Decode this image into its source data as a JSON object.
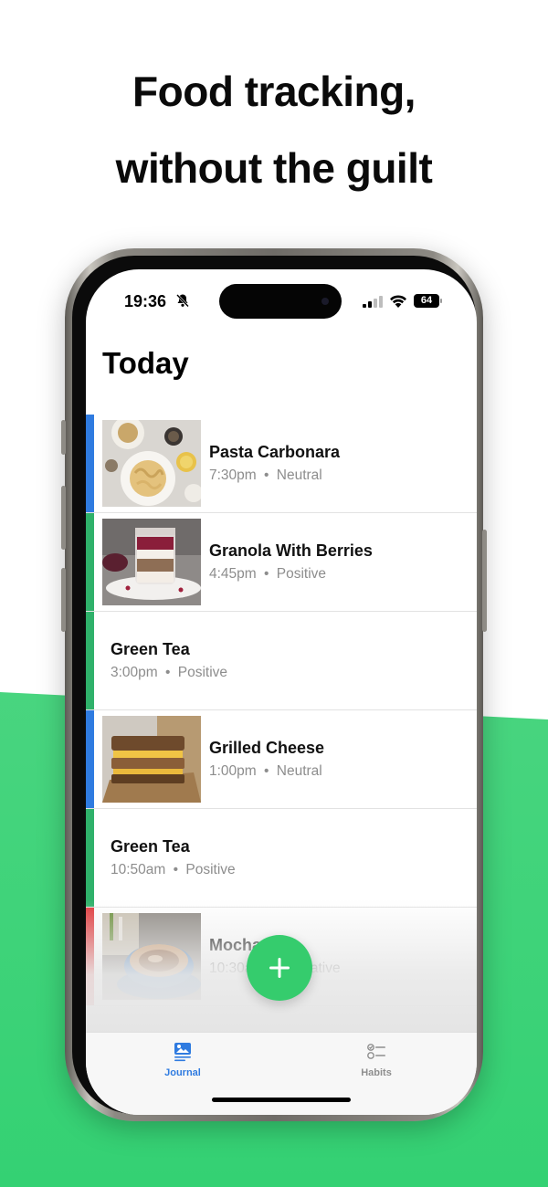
{
  "headline": {
    "line1": "Food tracking,",
    "line2": "without the guilt"
  },
  "status_bar": {
    "time": "19:36",
    "battery": "64",
    "icons": [
      "bell-slash-icon",
      "signal-icon",
      "wifi-icon",
      "battery-icon"
    ]
  },
  "page_title": "Today",
  "entries": [
    {
      "name": "Pasta Carbonara",
      "time": "7:30pm",
      "mood": "Neutral",
      "separator": "•",
      "color": "#2f7be0",
      "image": "pasta-carbonara-photo"
    },
    {
      "name": "Granola With Berries",
      "time": "4:45pm",
      "mood": "Positive",
      "separator": "•",
      "color": "#2fb16a",
      "image": "granola-jar-photo"
    },
    {
      "name": "Green Tea",
      "time": "3:00pm",
      "mood": "Positive",
      "separator": "•",
      "color": "#2fb16a",
      "image": null
    },
    {
      "name": "Grilled Cheese",
      "time": "1:00pm",
      "mood": "Neutral",
      "separator": "•",
      "color": "#2f7be0",
      "image": "grilled-cheese-photo"
    },
    {
      "name": "Green Tea",
      "time": "10:50am",
      "mood": "Positive",
      "separator": "•",
      "color": "#2fb16a",
      "image": null
    },
    {
      "name": "Mocha",
      "time": "10:30am",
      "mood": "Negative",
      "separator": "•",
      "color": "#e0383b",
      "image": "mocha-cup-photo"
    }
  ],
  "fab": {
    "icon": "plus-icon",
    "color": "#35cc6d"
  },
  "tabs": [
    {
      "label": "Journal",
      "icon": "journal-photo-icon",
      "active": true,
      "color": "#2f7be0"
    },
    {
      "label": "Habits",
      "icon": "checklist-icon",
      "active": false,
      "color": "#8e8e8e"
    }
  ],
  "colors": {
    "accent": "#35cc6d",
    "neutral_bar": "#2f7be0",
    "positive_bar": "#2fb16a",
    "negative_bar": "#e0383b"
  }
}
